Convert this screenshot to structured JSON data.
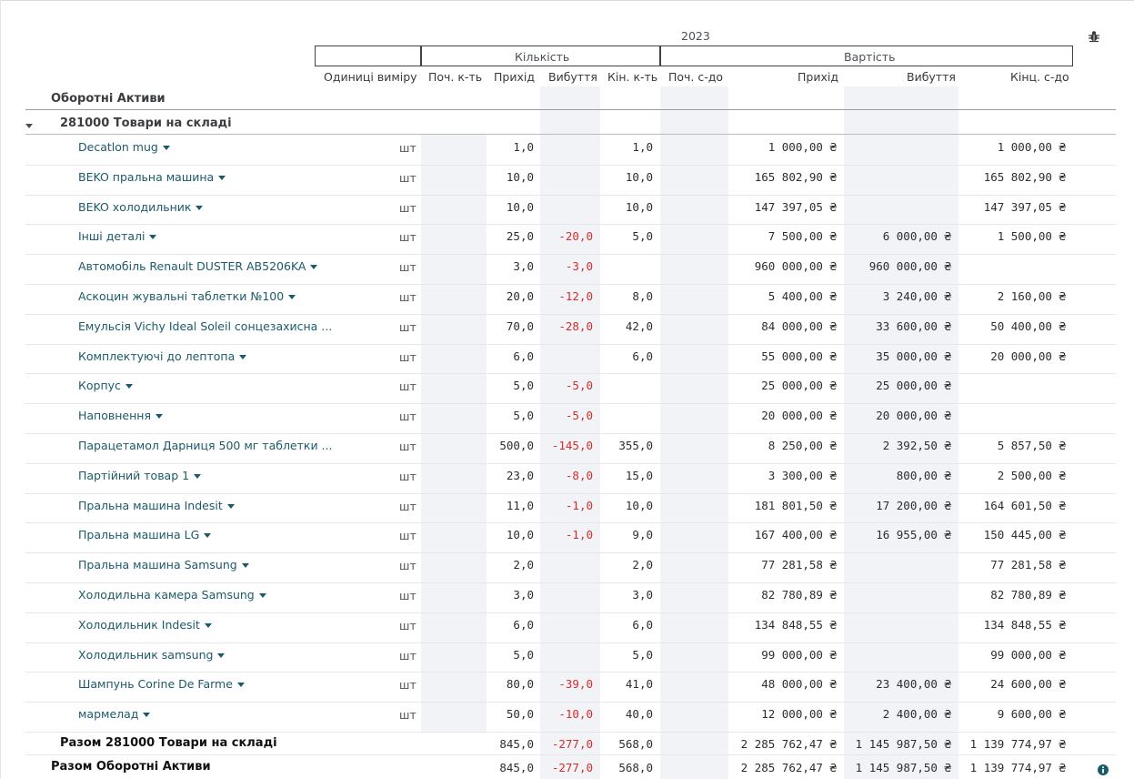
{
  "header": {
    "year": "2023",
    "group_quantity": "Кількість",
    "group_value": "Вартість",
    "columns": {
      "units": "Одиниці виміру",
      "qty_start": "Поч. к-ть",
      "qty_in": "Прихід",
      "qty_out": "Вибуття",
      "qty_end": "Кін. к-ть",
      "val_start": "Поч. с-до",
      "val_in": "Прихід",
      "val_out": "Вибуття",
      "val_end": "Кінц. с-до"
    }
  },
  "section_title": "Оборотні Активи",
  "account_title": "281000 Товари на складі",
  "rows": [
    {
      "name": "Decatlon mug",
      "unit": "шт",
      "qin": "1,0",
      "qout": "",
      "qend": "1,0",
      "vin": "1 000,00 ₴",
      "vout": "",
      "vend": "1 000,00 ₴"
    },
    {
      "name": "BEKO пральна машина",
      "unit": "шт",
      "qin": "10,0",
      "qout": "",
      "qend": "10,0",
      "vin": "165 802,90 ₴",
      "vout": "",
      "vend": "165 802,90 ₴"
    },
    {
      "name": "BEKO холодильник",
      "unit": "шт",
      "qin": "10,0",
      "qout": "",
      "qend": "10,0",
      "vin": "147 397,05 ₴",
      "vout": "",
      "vend": "147 397,05 ₴"
    },
    {
      "name": "Інші деталі",
      "unit": "шт",
      "qin": "25,0",
      "qout": "-20,0",
      "qend": "5,0",
      "vin": "7 500,00 ₴",
      "vout": "6 000,00 ₴",
      "vend": "1 500,00 ₴"
    },
    {
      "name": "Автомобіль Renault DUSTER AB5206KA",
      "unit": "шт",
      "qin": "3,0",
      "qout": "-3,0",
      "qend": "",
      "vin": "960 000,00 ₴",
      "vout": "960 000,00 ₴",
      "vend": ""
    },
    {
      "name": "Аскоцин жувальні таблетки №100",
      "unit": "шт",
      "qin": "20,0",
      "qout": "-12,0",
      "qend": "8,0",
      "vin": "5 400,00 ₴",
      "vout": "3 240,00 ₴",
      "vend": "2 160,00 ₴"
    },
    {
      "name": "Емульсія Vichy Ideal Soleil сонцезахисна ...",
      "unit": "шт",
      "qin": "70,0",
      "qout": "-28,0",
      "qend": "42,0",
      "vin": "84 000,00 ₴",
      "vout": "33 600,00 ₴",
      "vend": "50 400,00 ₴",
      "nocaret": true
    },
    {
      "name": "Комплектуючі до лептопа",
      "unit": "шт",
      "qin": "6,0",
      "qout": "",
      "qend": "6,0",
      "vin": "55 000,00 ₴",
      "vout": "35 000,00 ₴",
      "vend": "20 000,00 ₴"
    },
    {
      "name": "Корпус",
      "unit": "шт",
      "qin": "5,0",
      "qout": "-5,0",
      "qend": "",
      "vin": "25 000,00 ₴",
      "vout": "25 000,00 ₴",
      "vend": ""
    },
    {
      "name": "Наповнення",
      "unit": "шт",
      "qin": "5,0",
      "qout": "-5,0",
      "qend": "",
      "vin": "20 000,00 ₴",
      "vout": "20 000,00 ₴",
      "vend": ""
    },
    {
      "name": "Парацетамол Дарниця 500 мг таблетки ...",
      "unit": "шт",
      "qin": "500,0",
      "qout": "-145,0",
      "qend": "355,0",
      "vin": "8 250,00 ₴",
      "vout": "2 392,50 ₴",
      "vend": "5 857,50 ₴",
      "nocaret": true
    },
    {
      "name": "Партійний товар 1",
      "unit": "шт",
      "qin": "23,0",
      "qout": "-8,0",
      "qend": "15,0",
      "vin": "3 300,00 ₴",
      "vout": "800,00 ₴",
      "vend": "2 500,00 ₴"
    },
    {
      "name": "Пральна машина Indesit",
      "unit": "шт",
      "qin": "11,0",
      "qout": "-1,0",
      "qend": "10,0",
      "vin": "181 801,50 ₴",
      "vout": "17 200,00 ₴",
      "vend": "164 601,50 ₴"
    },
    {
      "name": "Пральна машина LG",
      "unit": "шт",
      "qin": "10,0",
      "qout": "-1,0",
      "qend": "9,0",
      "vin": "167 400,00 ₴",
      "vout": "16 955,00 ₴",
      "vend": "150 445,00 ₴"
    },
    {
      "name": "Пральна машина Samsung",
      "unit": "шт",
      "qin": "2,0",
      "qout": "",
      "qend": "2,0",
      "vin": "77 281,58 ₴",
      "vout": "",
      "vend": "77 281,58 ₴"
    },
    {
      "name": "Холодильна камера Samsung",
      "unit": "шт",
      "qin": "3,0",
      "qout": "",
      "qend": "3,0",
      "vin": "82 780,89 ₴",
      "vout": "",
      "vend": "82 780,89 ₴"
    },
    {
      "name": "Холодильник Indesit",
      "unit": "шт",
      "qin": "6,0",
      "qout": "",
      "qend": "6,0",
      "vin": "134 848,55 ₴",
      "vout": "",
      "vend": "134 848,55 ₴"
    },
    {
      "name": "Холодильник samsung",
      "unit": "шт",
      "qin": "5,0",
      "qout": "",
      "qend": "5,0",
      "vin": "99 000,00 ₴",
      "vout": "",
      "vend": "99 000,00 ₴"
    },
    {
      "name": "Шампунь Corine De Farme",
      "unit": "шт",
      "qin": "80,0",
      "qout": "-39,0",
      "qend": "41,0",
      "vin": "48 000,00 ₴",
      "vout": "23 400,00 ₴",
      "vend": "24 600,00 ₴"
    },
    {
      "name": "мармелад",
      "unit": "шт",
      "qin": "50,0",
      "qout": "-10,0",
      "qend": "40,0",
      "vin": "12 000,00 ₴",
      "vout": "2 400,00 ₴",
      "vend": "9 600,00 ₴"
    }
  ],
  "totals": [
    {
      "label": "Разом 281000 Товари на складі",
      "qin": "845,0",
      "qout": "-277,0",
      "qend": "568,0",
      "vin": "2 285 762,47 ₴",
      "vout": "1 145 987,50 ₴",
      "vend": "1 139 774,97 ₴"
    },
    {
      "label": "Разом Оборотні Активи",
      "qin": "845,0",
      "qout": "-277,0",
      "qend": "568,0",
      "vin": "2 285 762,47 ₴",
      "vout": "1 145 987,50 ₴",
      "vend": "1 139 774,97 ₴"
    }
  ],
  "icons": {
    "debug": "bug-icon",
    "info": "info-icon",
    "collapse": "caret-down-icon",
    "row_menu": "caret-down-icon"
  },
  "colors": {
    "link": "#1b5a6a",
    "negative": "#d42d2d",
    "shade": "#f2f3f6"
  }
}
